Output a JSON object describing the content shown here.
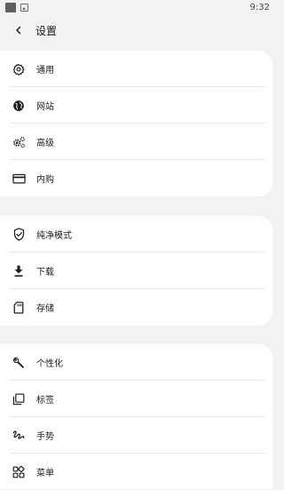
{
  "status_bar": {
    "time": "9:32"
  },
  "header": {
    "title": "设置"
  },
  "groups": [
    {
      "items": [
        {
          "label": "通用",
          "icon": "gear-icon"
        },
        {
          "label": "网站",
          "icon": "globe-icon"
        },
        {
          "label": "高级",
          "icon": "gears-icon"
        },
        {
          "label": "内购",
          "icon": "credit-card-icon"
        }
      ]
    },
    {
      "items": [
        {
          "label": "纯净模式",
          "icon": "shield-check-icon"
        },
        {
          "label": "下载",
          "icon": "download-icon"
        },
        {
          "label": "存储",
          "icon": "sd-card-icon"
        }
      ]
    },
    {
      "items": [
        {
          "label": "个性化",
          "icon": "wrench-icon"
        },
        {
          "label": "标签",
          "icon": "tabs-icon"
        },
        {
          "label": "手势",
          "icon": "gesture-icon"
        },
        {
          "label": "菜单",
          "icon": "menu-grid-icon"
        }
      ]
    }
  ]
}
